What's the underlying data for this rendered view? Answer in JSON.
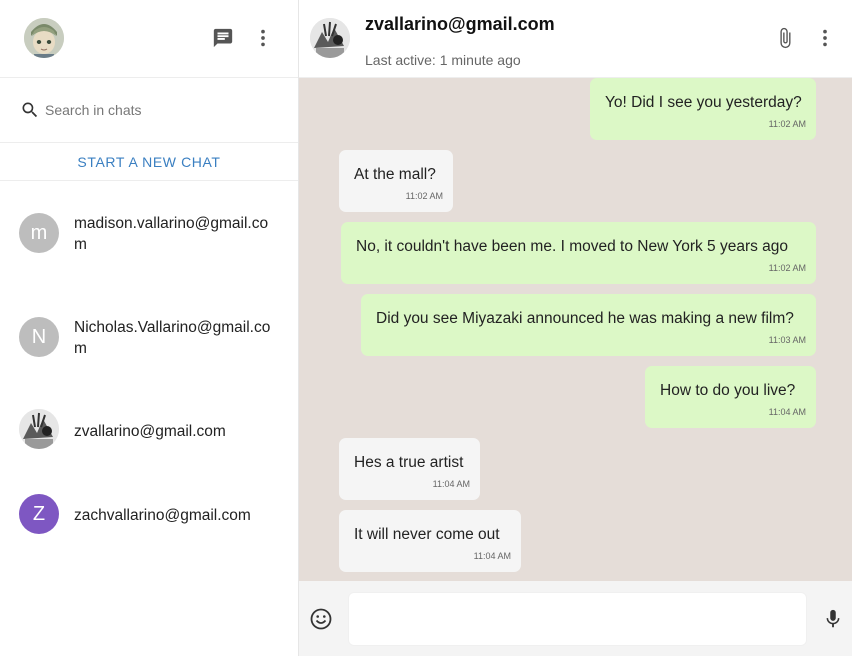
{
  "icons": {
    "new_chat": "message-icon",
    "more": "more-vert-icon",
    "search": "search-icon",
    "attach": "paperclip-icon",
    "emoji": "emoji-icon",
    "mic": "mic-icon"
  },
  "colors": {
    "link_blue": "#3a7fc1",
    "outgoing_bubble": "#dcf8c6",
    "incoming_bubble": "#f5f5f5",
    "chat_background": "#e5ddd8",
    "avatar_grey": "#bdbdbd",
    "avatar_purple": "#7e57c2"
  },
  "search": {
    "placeholder": "Search in chats"
  },
  "sidebar": {
    "new_chat_label": "START A NEW CHAT"
  },
  "contacts": [
    {
      "name": "madison.vallarino@gmail.com",
      "initial": "m",
      "avatar": "letter-grey"
    },
    {
      "name": "Nicholas.Vallarino@gmail.com",
      "initial": "N",
      "avatar": "letter-grey"
    },
    {
      "name": "zvallarino@gmail.com",
      "initial": "",
      "avatar": "photo"
    },
    {
      "name": "zachvallarino@gmail.com",
      "initial": "Z",
      "avatar": "letter-purple"
    }
  ],
  "chat": {
    "title": "zvallarino@gmail.com",
    "status": "Last active: 1 minute ago",
    "messages": [
      {
        "text": "Yo! Did I see you yesterday?",
        "time": "11:02 AM",
        "direction": "out"
      },
      {
        "text": "At the mall?",
        "time": "11:02 AM",
        "direction": "in"
      },
      {
        "text": "No, it couldn't have been me. I moved to New York 5 years ago",
        "time": "11:02 AM",
        "direction": "out"
      },
      {
        "text": "Did you see Miyazaki announced he was making a new film?",
        "time": "11:03 AM",
        "direction": "out"
      },
      {
        "text": "How to do you live?",
        "time": "11:04 AM",
        "direction": "out"
      },
      {
        "text": "Hes a true artist",
        "time": "11:04 AM",
        "direction": "in"
      },
      {
        "text": "It will never come out",
        "time": "11:04 AM",
        "direction": "in"
      }
    ],
    "input_value": ""
  }
}
